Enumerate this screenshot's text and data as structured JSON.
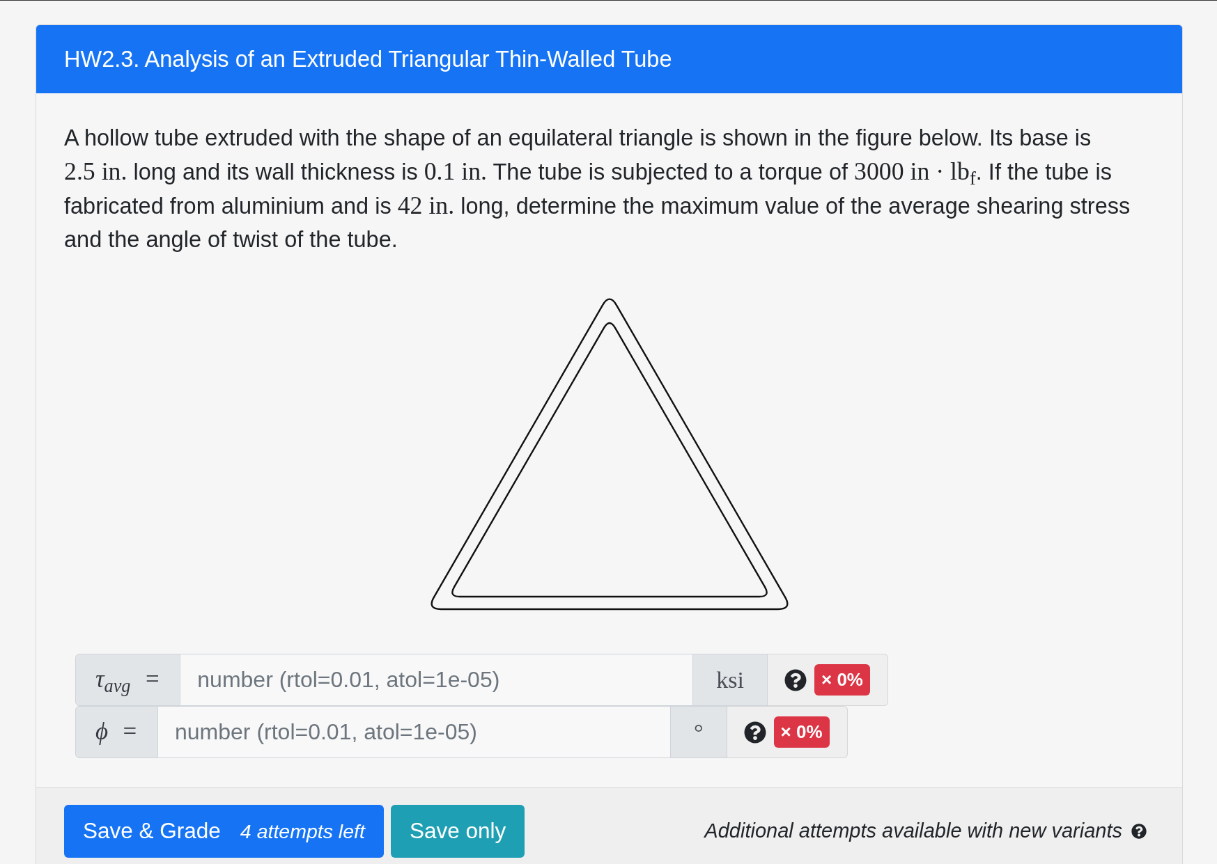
{
  "card": {
    "title": "HW2.3. Analysis of an Extruded Triangular Thin-Walled Tube"
  },
  "problem": {
    "lines": [
      [
        {
          "kind": "text",
          "text": "A hollow tube extruded with the shape of an equilateral triangle is shown in the figure below. Its base is"
        }
      ],
      [
        {
          "kind": "math",
          "text": "2.5 in."
        },
        {
          "kind": "text",
          "text": " long and its wall thickness is "
        },
        {
          "kind": "math",
          "text": "0.1 in."
        },
        {
          "kind": "text",
          "text": " The tube is subjected to a torque of "
        },
        {
          "kind": "math",
          "text": "3000 in · lb$_{f}$"
        },
        {
          "kind": "text",
          "text": ". If the tube is"
        }
      ],
      [
        {
          "kind": "text",
          "text": "fabricated from aluminium and is "
        },
        {
          "kind": "math",
          "text": "42 in."
        },
        {
          "kind": "text",
          "text": " long, determine the maximum value of the average shearing stress"
        }
      ],
      [
        {
          "kind": "text",
          "text": "and the angle of twist of the tube."
        }
      ]
    ]
  },
  "answers": [
    {
      "label": "τ$_{avg}$ =",
      "placeholder": "number (rtol=0.01, atol=1e-05)",
      "unit": "ksi",
      "score": "× 0%"
    },
    {
      "label": "ϕ =",
      "placeholder": "number (rtol=0.01, atol=1e-05)",
      "unit": "°",
      "score": "× 0%"
    }
  ],
  "footer": {
    "buttons": [
      {
        "kind": "primary",
        "label": "Save & Grade",
        "note": "4 attempts left"
      },
      {
        "kind": "info",
        "label": "Save only"
      }
    ],
    "note": "Additional attempts available with new variants"
  }
}
